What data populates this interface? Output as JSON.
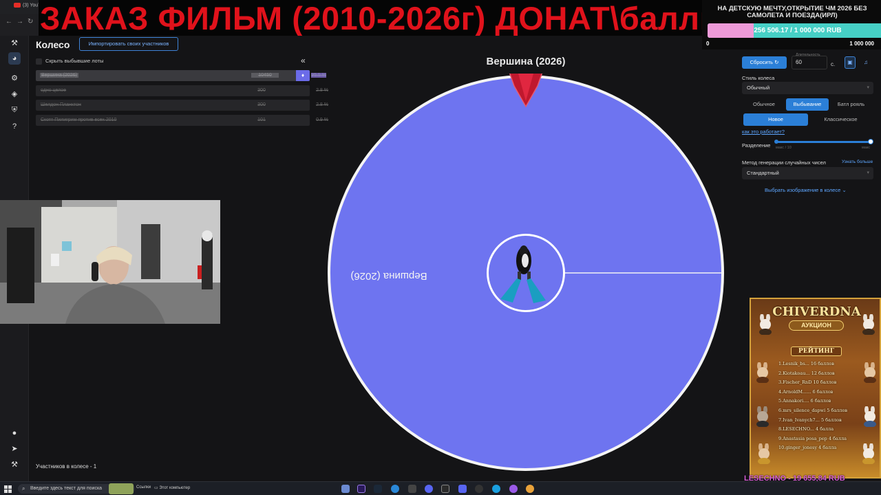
{
  "browser": {
    "tab_label": "(3) YouTu"
  },
  "overlay": {
    "title": "ЗАКАЗ ФИЛЬМ (2010-2026г) ДОНАТ\\баллы"
  },
  "goal": {
    "text": "НА ДЕТСКУЮ МЕЧТУ,ОТКРЫТИЕ ЧМ 2026 БЕЗ САМОЛЕТА И ПОЕЗДА(ИРЛ)",
    "amount": "256 506.17 / 1 000 000 RUB",
    "progress": 0.2565,
    "min_label": "0",
    "max_label": "1 000 000",
    "bar_color": "#46d0c6",
    "fill_color": "#ee9ad8"
  },
  "nav": {
    "icons": [
      "gavel-icon",
      "wheel-icon",
      "settings-icon",
      "layers-icon",
      "shield-icon",
      "help-icon",
      "github-icon",
      "telegram-icon",
      "stream-icon"
    ]
  },
  "panel": {
    "title": "Колесо",
    "import_button": "Импортировать своих участников",
    "hide_lots_label": "Скрыть выбывшие лоты",
    "collapse_glyph": "«",
    "lots": [
      {
        "name": "Вершина (2026)",
        "amount": "10450",
        "percent": "95.5 %"
      },
      {
        "name": "одно целое",
        "amount": "300",
        "percent": "2.8 %"
      },
      {
        "name": "Шелдон Планктон",
        "amount": "300",
        "percent": "2.8 %"
      },
      {
        "name": "Скотт Пилигрим против всех 2010",
        "amount": "101",
        "percent": "0.9 %"
      }
    ],
    "participants_label": "Участников в колесе - 1"
  },
  "wheel": {
    "winner_label": "Вершина (2026)",
    "segment_label": "Вершина (2026)",
    "segment_color": "#6e74f0",
    "border_color": "#f4f4f4"
  },
  "settings": {
    "reset_button": "Сбросить",
    "duration_label": "Длительность",
    "duration_value": "60",
    "duration_unit": "с.",
    "wheel_style_label": "Стиль колеса",
    "wheel_style_value": "Обычный",
    "mode_tabs": [
      "Обычное",
      "Выбывание",
      "Батл рояль"
    ],
    "mode_active": "Выбывание",
    "variant_tabs": [
      "Новое",
      "Классическое"
    ],
    "variant_active": "Новое",
    "how_link": "как это работает?",
    "split_label": "Разделение",
    "split_min": "макс / 10",
    "split_max": "макс",
    "rng_label": "Метод генерации случайных чисел",
    "rng_link": "Узнать больше",
    "rng_value": "Стандартный",
    "image_link": "Выбрать изображение в колесе",
    "accent_color": "#2b7fd7"
  },
  "banner": {
    "title": "CHIVERDNA",
    "subtitle": "АУКЦИОН",
    "rating_label": "РЕЙТИНГ",
    "ranks": [
      "1.Lesnik_bs... 16 баллов",
      "2.Kiotakoau... 12 баллов",
      "3.Fischer_RnD 10 баллов",
      "4.ArnoldM...... 6 баллов",
      "5.Annakori.... 6 баллов",
      "6.mrs_silence_dapwi 5 баллов",
      "7.Ivan_Ivanych7... 5 баллов",
      "8.LESECHNO... 4 балла",
      "9.Anastasia posa_pep 4 балла",
      "10.ginger_jonesy 4 балла"
    ],
    "footer": "LESECHNO - 19 655,84 RUB"
  },
  "taskbar": {
    "search_placeholder": "Введите здесь текст для поиска",
    "links_label": "Ссылки",
    "this_pc_label": "Этот компьютер"
  }
}
